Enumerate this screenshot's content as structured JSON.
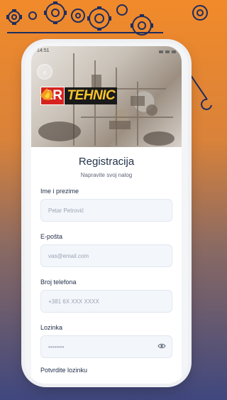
{
  "status_bar": {
    "time": "14:51"
  },
  "brand": {
    "logo_part1": "AR",
    "logo_part2": "TEHNIC"
  },
  "header": {
    "title": "Registracija",
    "subtitle": "Napravite svoj nalog"
  },
  "fields": [
    {
      "label": "Ime i prezime",
      "placeholder": "Petar Petrović"
    },
    {
      "label": "E-pošta",
      "placeholder": "vas@email.com"
    },
    {
      "label": "Broj telefona",
      "placeholder": "+381 6X XXX XXXX"
    },
    {
      "label": "Lozinka",
      "placeholder": "••••••••"
    },
    {
      "label": "Potvrdite lozinku"
    }
  ],
  "colors": {
    "accent_orange": "#f18a2a",
    "navy": "#3f477e",
    "logo_red": "#d6231f",
    "title_text": "#23324a"
  },
  "icons": [
    "gear-icon",
    "wrench-icon",
    "back-arrow-icon",
    "eye-icon",
    "flame-icon"
  ]
}
